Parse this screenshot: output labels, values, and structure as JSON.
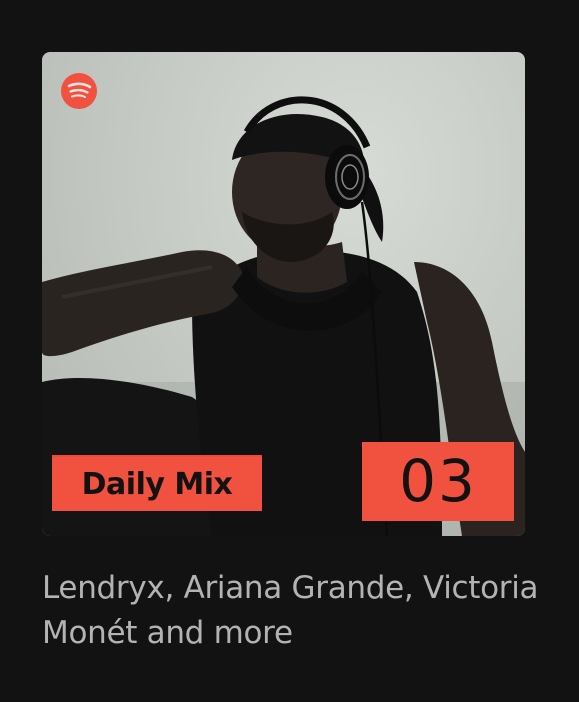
{
  "playlist": {
    "title": "Daily Mix",
    "number": "03",
    "description": "Lendryx, Ariana Grande, Victoria Monét and more",
    "logo_icon": "spotify-logo-icon"
  },
  "colors": {
    "background": "#121212",
    "accent": "#f1513f",
    "badge_text": "#121212",
    "subtitle_text": "#b3b3b3"
  }
}
